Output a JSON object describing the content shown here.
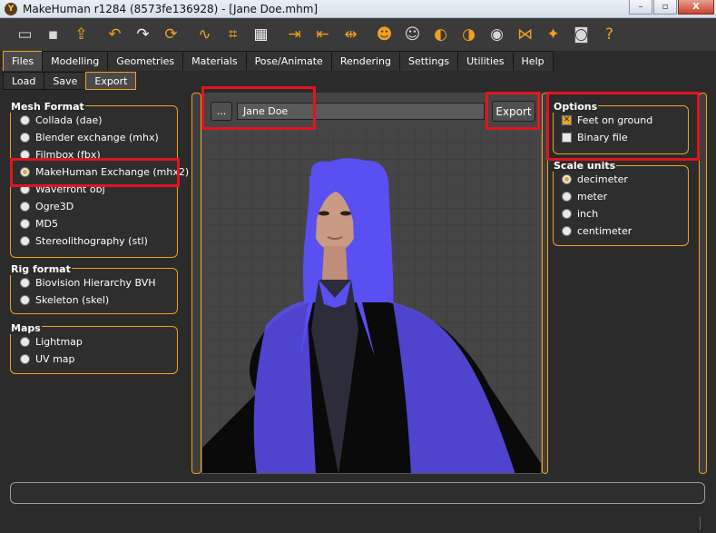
{
  "window": {
    "app_icon_letter": "Y",
    "title": "MakeHuman r1284 (8573fe136928) - [Jane Doe.mhm]",
    "controls": [
      "–",
      "▫",
      "X"
    ]
  },
  "toolbar": {
    "icons": [
      {
        "name": "new-file-icon",
        "glyph": "▭",
        "color": "#d8d8d8"
      },
      {
        "name": "save-icon",
        "glyph": "▪",
        "color": "#d8d8d8"
      },
      {
        "name": "export-icon",
        "glyph": "⇪",
        "color": "#f0a020"
      },
      {
        "name": "undo-icon",
        "glyph": "↶",
        "color": "#f0a020"
      },
      {
        "name": "redo-icon",
        "glyph": "↷",
        "color": "#f4f4f4"
      },
      {
        "name": "reset-icon",
        "glyph": "⟳",
        "color": "#f0a020"
      },
      {
        "name": "smooth-icon",
        "glyph": "∿",
        "color": "#f0a020"
      },
      {
        "name": "wireframe-icon",
        "glyph": "⌗",
        "color": "#f0a020"
      },
      {
        "name": "background-icon",
        "glyph": "▦",
        "color": "#f4f4f4"
      },
      {
        "name": "pose-front-icon",
        "glyph": "⇥",
        "color": "#f0a020"
      },
      {
        "name": "pose-back-icon",
        "glyph": "⇤",
        "color": "#f0a020"
      },
      {
        "name": "pose-side-icon",
        "glyph": "⇹",
        "color": "#f0a020"
      },
      {
        "name": "front-view-icon",
        "glyph": "☻",
        "color": "#f0a020"
      },
      {
        "name": "back-view-icon",
        "glyph": "☺",
        "color": "#d8d8d8"
      },
      {
        "name": "left-view-icon",
        "glyph": "◐",
        "color": "#f0a020"
      },
      {
        "name": "right-view-icon",
        "glyph": "◑",
        "color": "#f0a020"
      },
      {
        "name": "top-view-icon",
        "glyph": "◉",
        "color": "#d8d8d8"
      },
      {
        "name": "symmetry-icon",
        "glyph": "⋈",
        "color": "#f0a020"
      },
      {
        "name": "pose-icon",
        "glyph": "✦",
        "color": "#f0a020"
      },
      {
        "name": "screenshot-icon",
        "glyph": "◙",
        "color": "#d8d8d8"
      },
      {
        "name": "help-icon",
        "glyph": "?",
        "color": "#f0a020"
      }
    ]
  },
  "tabs": [
    "Files",
    "Modelling",
    "Geometries",
    "Materials",
    "Pose/Animate",
    "Rendering",
    "Settings",
    "Utilities",
    "Help"
  ],
  "active_tab": "Files",
  "subtabs": [
    "Load",
    "Save",
    "Export"
  ],
  "active_subtab": "Export",
  "left": {
    "mesh_format": {
      "title": "Mesh Format",
      "items": [
        "Collada (dae)",
        "Blender exchange (mhx)",
        "Filmbox (fbx)",
        "MakeHuman Exchange (mhx2)",
        "Wavefront obj",
        "Ogre3D",
        "MD5",
        "Stereolithography (stl)"
      ],
      "selected": "MakeHuman Exchange (mhx2)"
    },
    "rig_format": {
      "title": "Rig format",
      "items": [
        "Biovision Hierarchy BVH",
        "Skeleton (skel)"
      ]
    },
    "maps": {
      "title": "Maps",
      "items": [
        "Lightmap",
        "UV map"
      ]
    }
  },
  "center": {
    "browse_label": "...",
    "filename": "Jane Doe",
    "export_label": "Export"
  },
  "right": {
    "options": {
      "title": "Options",
      "items": [
        {
          "label": "Feet on ground",
          "checked": true
        },
        {
          "label": "Binary file",
          "checked": false
        }
      ]
    },
    "scale_units": {
      "title": "Scale units",
      "items": [
        "decimeter",
        "meter",
        "inch",
        "centimeter"
      ],
      "selected": "decimeter"
    }
  },
  "colors": {
    "accent": "#f0a020",
    "highlight": "#e0151e",
    "model_body": "#5a4ff0"
  }
}
